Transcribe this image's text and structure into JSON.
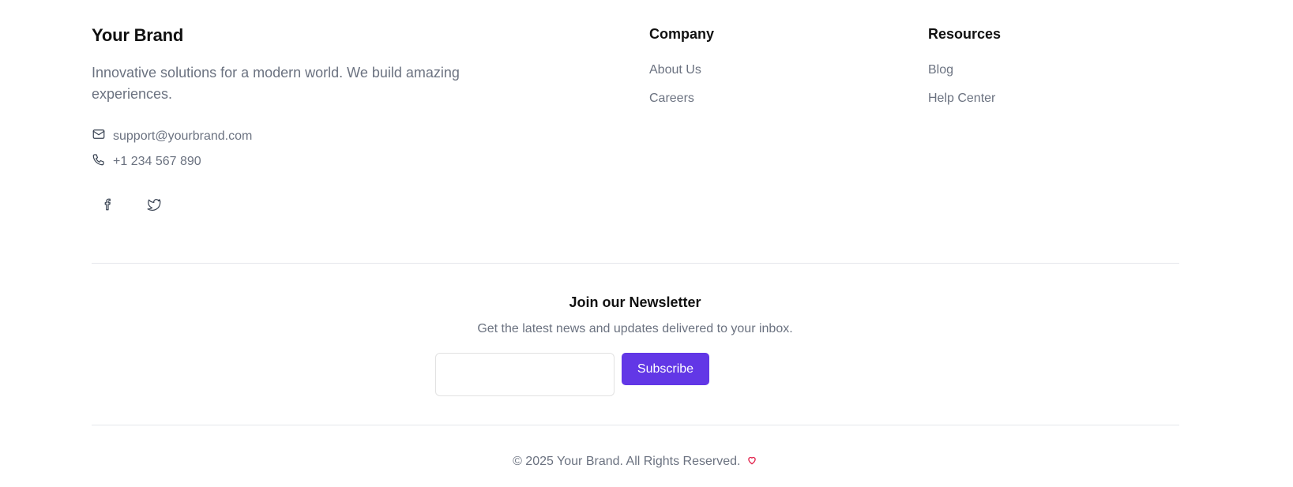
{
  "brand": {
    "name": "Your Brand",
    "description": "Innovative solutions for a modern world. We build amazing experiences.",
    "email": "support@yourbrand.com",
    "phone": "+1 234 567 890",
    "social_icons": [
      "facebook-icon",
      "twitter-icon"
    ]
  },
  "columns": {
    "company": {
      "title": "Company",
      "links": [
        "About Us",
        "Careers"
      ]
    },
    "resources": {
      "title": "Resources",
      "links": [
        "Blog",
        "Help Center"
      ]
    }
  },
  "newsletter": {
    "title": "Join our Newsletter",
    "subtitle": "Get the latest news and updates delivered to your inbox.",
    "input_value": "",
    "button_label": "Subscribe"
  },
  "copyright": {
    "text": "© 2025 Your Brand. All Rights Reserved."
  },
  "colors": {
    "accent": "#6237e6",
    "heart": "#e11d48",
    "muted_text": "#6b7280",
    "divider": "#e5e7eb"
  }
}
